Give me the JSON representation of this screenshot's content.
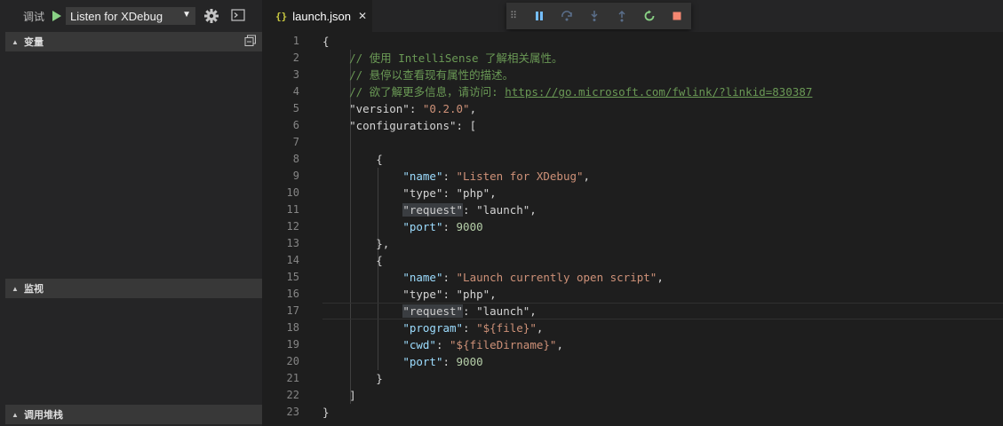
{
  "sidebar": {
    "title": "调试",
    "config_selected": "Listen for XDebug",
    "sections": [
      {
        "label": "变量"
      },
      {
        "label": "监视"
      },
      {
        "label": "调用堆栈"
      }
    ]
  },
  "tab": {
    "icon_text": "{}",
    "name": "launch.json",
    "close": "✕"
  },
  "colors": {
    "accent_green": "#89d185",
    "stop_red": "#f48771",
    "blue": "#75beff"
  },
  "editor": {
    "lines": [
      {
        "n": "1",
        "tokens": [
          [
            "p",
            "{"
          ]
        ]
      },
      {
        "n": "2",
        "tokens": [
          [
            "p",
            "    "
          ],
          [
            "c",
            "// 使用 IntelliSense 了解相关属性。"
          ]
        ]
      },
      {
        "n": "3",
        "tokens": [
          [
            "p",
            "    "
          ],
          [
            "c",
            "// 悬停以查看现有属性的描述。"
          ]
        ]
      },
      {
        "n": "4",
        "tokens": [
          [
            "p",
            "    "
          ],
          [
            "c",
            "// 欲了解更多信息，请访问: "
          ],
          [
            "u",
            "https://go.microsoft.com/fwlink/?linkid=830387"
          ]
        ]
      },
      {
        "n": "5",
        "tokens": [
          [
            "p",
            "    \"version\": "
          ],
          [
            "s",
            "\"0.2.0\""
          ],
          [
            "p",
            ","
          ]
        ]
      },
      {
        "n": "6",
        "tokens": [
          [
            "p",
            "    \"configurations\": ["
          ]
        ]
      },
      {
        "n": "7",
        "tokens": []
      },
      {
        "n": "8",
        "tokens": [
          [
            "p",
            "        {"
          ]
        ]
      },
      {
        "n": "9",
        "tokens": [
          [
            "p",
            "            "
          ],
          [
            "k",
            "\"name\""
          ],
          [
            "p",
            ": "
          ],
          [
            "s",
            "\"Listen for XDebug\""
          ],
          [
            "p",
            ","
          ]
        ]
      },
      {
        "n": "10",
        "tokens": [
          [
            "p",
            "            \"type\": \"php\","
          ]
        ]
      },
      {
        "n": "11",
        "tokens": [
          [
            "p",
            "            "
          ],
          [
            "hl",
            "\"request\""
          ],
          [
            "p",
            ": \"launch\","
          ]
        ]
      },
      {
        "n": "12",
        "tokens": [
          [
            "p",
            "            "
          ],
          [
            "k",
            "\"port\""
          ],
          [
            "p",
            ": "
          ],
          [
            "n",
            "9000"
          ]
        ]
      },
      {
        "n": "13",
        "tokens": [
          [
            "p",
            "        },"
          ]
        ]
      },
      {
        "n": "14",
        "tokens": [
          [
            "p",
            "        {"
          ]
        ]
      },
      {
        "n": "15",
        "tokens": [
          [
            "p",
            "            "
          ],
          [
            "k",
            "\"name\""
          ],
          [
            "p",
            ": "
          ],
          [
            "s",
            "\"Launch currently open script\""
          ],
          [
            "p",
            ","
          ]
        ]
      },
      {
        "n": "16",
        "tokens": [
          [
            "p",
            "            \"type\": \"php\","
          ]
        ]
      },
      {
        "n": "17",
        "tokens": [
          [
            "p",
            "            "
          ],
          [
            "hl",
            "\"request\""
          ],
          [
            "p",
            ": \"launch\","
          ]
        ]
      },
      {
        "n": "18",
        "tokens": [
          [
            "p",
            "            "
          ],
          [
            "k",
            "\"program\""
          ],
          [
            "p",
            ": "
          ],
          [
            "s",
            "\"${file}\""
          ],
          [
            "p",
            ","
          ]
        ]
      },
      {
        "n": "19",
        "tokens": [
          [
            "p",
            "            "
          ],
          [
            "k",
            "\"cwd\""
          ],
          [
            "p",
            ": "
          ],
          [
            "s",
            "\"${fileDirname}\""
          ],
          [
            "p",
            ","
          ]
        ]
      },
      {
        "n": "20",
        "tokens": [
          [
            "p",
            "            "
          ],
          [
            "k",
            "\"port\""
          ],
          [
            "p",
            ": "
          ],
          [
            "n",
            "9000"
          ]
        ]
      },
      {
        "n": "21",
        "tokens": [
          [
            "p",
            "        }"
          ]
        ]
      },
      {
        "n": "22",
        "tokens": [
          [
            "p",
            "    ]"
          ]
        ]
      },
      {
        "n": "23",
        "tokens": [
          [
            "p",
            "}"
          ]
        ]
      }
    ],
    "current_line": "17"
  }
}
